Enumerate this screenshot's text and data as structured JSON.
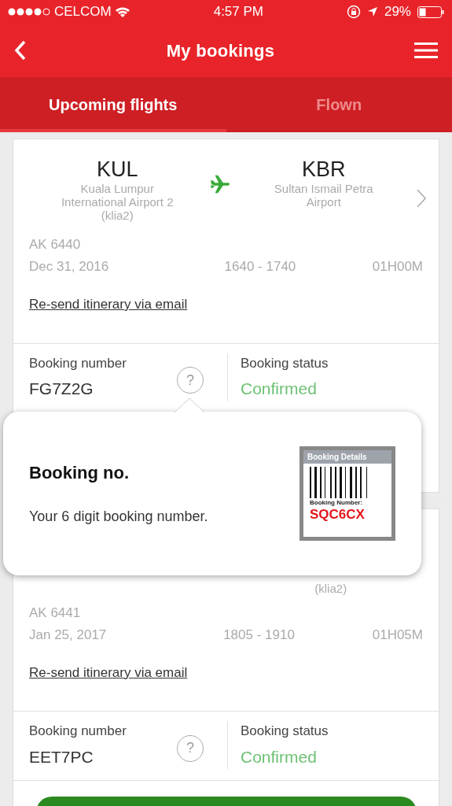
{
  "status_bar": {
    "carrier": "CELCOM",
    "time": "4:57 PM",
    "battery": "29%"
  },
  "header": {
    "title": "My bookings"
  },
  "tabs": [
    {
      "label": "Upcoming flights",
      "selected": true
    },
    {
      "label": "Flown",
      "selected": false
    }
  ],
  "bookings": [
    {
      "origin_code": "KUL",
      "origin_name": [
        "Kuala Lumpur",
        "International Airport 2",
        "(klia2)"
      ],
      "dest_code": "KBR",
      "dest_name": [
        "Sultan Ismail Petra",
        "Airport"
      ],
      "flight": "AK 6440",
      "date": "Dec 31, 2016",
      "times": "1640 - 1740",
      "duration": "01H00M",
      "resend_link": "Re-send itinerary via email",
      "booking_number_label": "Booking number",
      "booking_number": "FG7Z2G",
      "help_icon": "?",
      "booking_status_label": "Booking status",
      "booking_status": "Confirmed"
    },
    {
      "dest_name": [
        "(klia2)"
      ],
      "flight": "AK 6441",
      "date": "Jan 25, 2017",
      "times": "1805 - 1910",
      "duration": "01H05M",
      "resend_link": "Re-send itinerary via email",
      "booking_number_label": "Booking number",
      "booking_number": "EET7PC",
      "help_icon": "?",
      "booking_status_label": "Booking status",
      "booking_status": "Confirmed"
    }
  ],
  "popover": {
    "title": "Booking no.",
    "text": "Your 6 digit booking number.",
    "example": {
      "header": "Booking Details",
      "label": "Booking Number:",
      "number": "SQC6CX"
    }
  }
}
